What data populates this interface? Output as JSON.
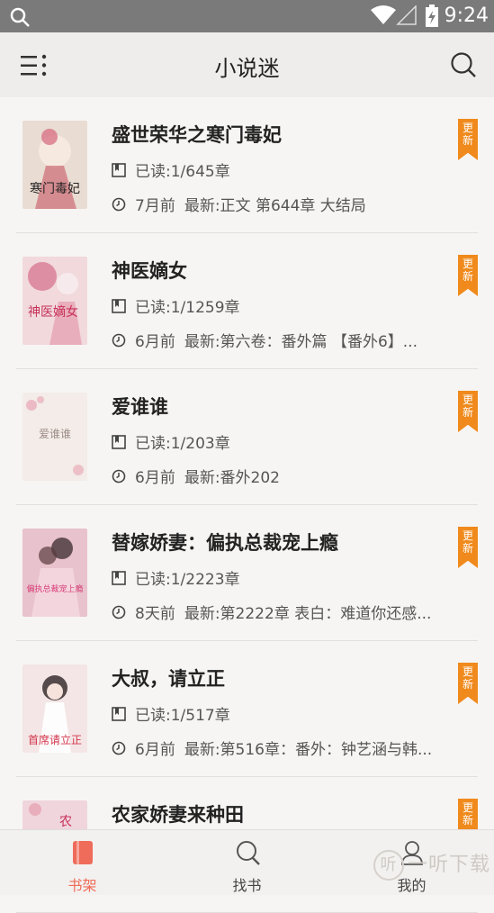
{
  "status_bar": {
    "time": "9:24"
  },
  "header": {
    "title": "小说迷"
  },
  "ribbon_text": "更新",
  "books": [
    {
      "title": "盛世荣华之寒门毒妃",
      "read": "已读:1/645章",
      "ago": "7月前",
      "latest": "最新:正文 第644章 大结局"
    },
    {
      "title": "神医嫡女",
      "read": "已读:1/1259章",
      "ago": "6月前",
      "latest": "最新:第六卷：番外篇 【番外6】..."
    },
    {
      "title": "爱谁谁",
      "read": "已读:1/203章",
      "ago": "6月前",
      "latest": "最新:番外202"
    },
    {
      "title": "替嫁娇妻：偏执总裁宠上瘾",
      "read": "已读:1/2223章",
      "ago": "8天前",
      "latest": "最新:第2222章 表白：难道你还感..."
    },
    {
      "title": "大叔，请立正",
      "read": "已读:1/517章",
      "ago": "6月前",
      "latest": "最新:第516章：番外：钟艺涵与韩..."
    },
    {
      "title": "农家娇妻来种田",
      "read": "",
      "ago": "",
      "latest": ""
    }
  ],
  "covers": [
    {
      "text": "寒门毒妃",
      "bg": "#e9dcd2",
      "accent": "#c44a5a"
    },
    {
      "text": "神医嫡女",
      "bg": "#f1d9dc",
      "accent": "#c8325a"
    },
    {
      "text": "爱谁谁",
      "bg": "#f3ece8",
      "accent": "#9d8c86"
    },
    {
      "text": "偏执总裁宠上瘾",
      "bg": "#e8c2cc",
      "accent": "#d83e78"
    },
    {
      "text": "首席请立正",
      "bg": "#f4e6e6",
      "accent": "#d2344a"
    },
    {
      "text": "农",
      "bg": "#f0d5dd",
      "accent": "#c8325a"
    }
  ],
  "bottom_nav": [
    {
      "label": "书架",
      "icon": "bookshelf-icon",
      "active": true
    },
    {
      "label": "找书",
      "icon": "search-book-icon",
      "active": false
    },
    {
      "label": "我的",
      "icon": "profile-icon",
      "active": false
    }
  ],
  "watermark": "一听下载",
  "colors": {
    "ribbon": "#f08a1c",
    "active_tab": "#ef6b5a"
  }
}
